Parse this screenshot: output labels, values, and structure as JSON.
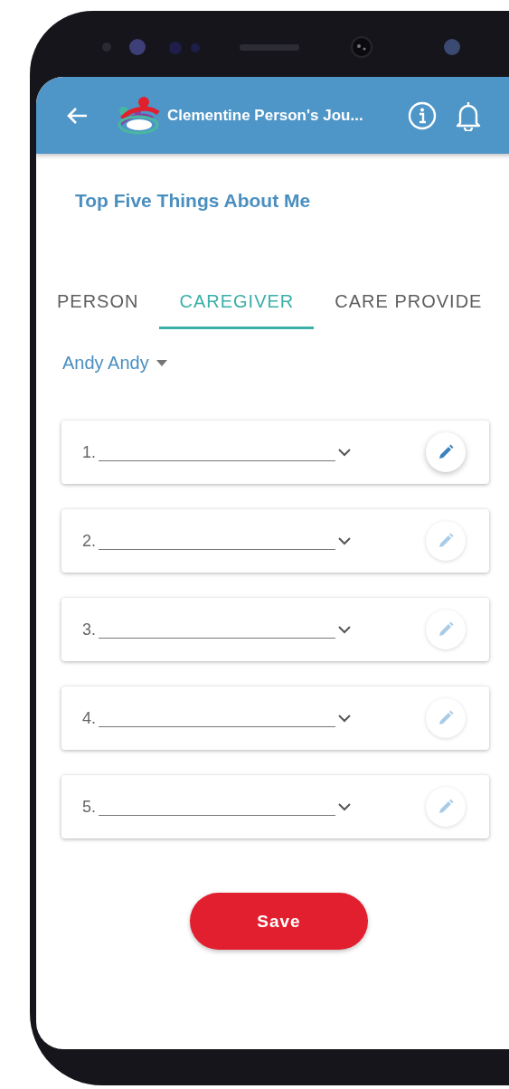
{
  "header": {
    "title": "Clementine Person's Jou..."
  },
  "heading": "Top Five Things About Me",
  "tabs": [
    {
      "label": "PERSON",
      "selected": false
    },
    {
      "label": "CAREGIVER",
      "selected": true
    },
    {
      "label": "CARE PROVIDE",
      "selected": false
    }
  ],
  "person_select": {
    "value": "Andy Andy"
  },
  "items": [
    {
      "number": "1.",
      "disabled": false
    },
    {
      "number": "2.",
      "disabled": true
    },
    {
      "number": "3.",
      "disabled": true
    },
    {
      "number": "4.",
      "disabled": true
    },
    {
      "number": "5.",
      "disabled": true
    }
  ],
  "save_button": {
    "label": "Save"
  }
}
